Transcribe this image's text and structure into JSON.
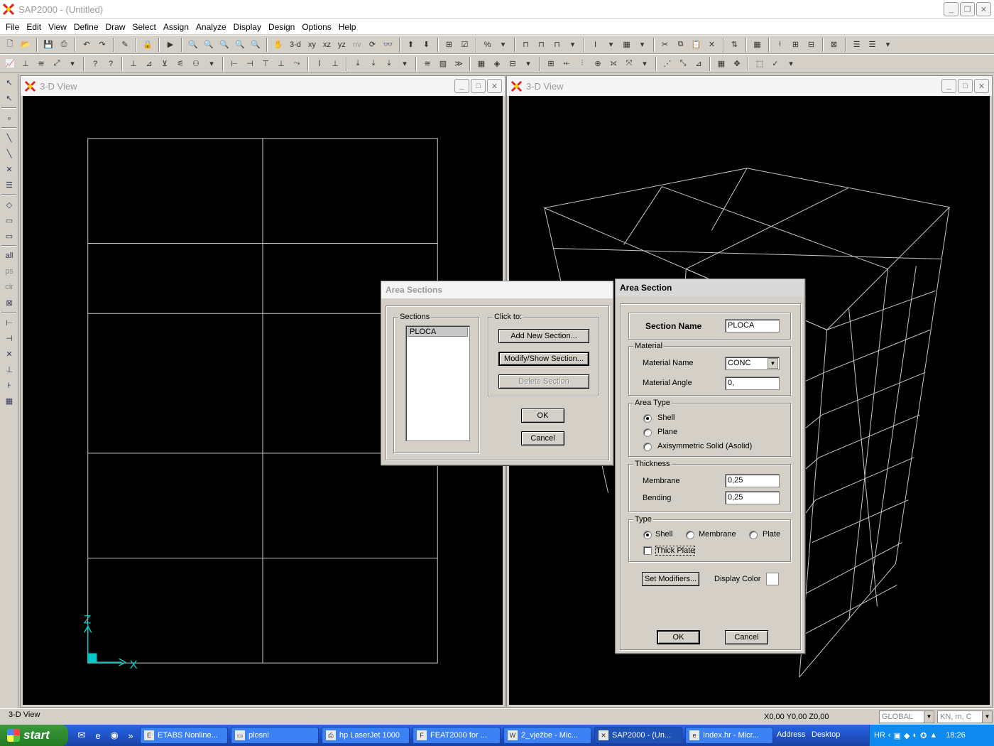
{
  "app": {
    "title": "SAP2000 - (Untitled)"
  },
  "menu": [
    "File",
    "Edit",
    "View",
    "Define",
    "Draw",
    "Select",
    "Assign",
    "Analyze",
    "Display",
    "Design",
    "Options",
    "Help"
  ],
  "toolbar1": {
    "view_3d": "3-d",
    "view_xy": "xy",
    "view_xz": "xz",
    "view_yz": "yz",
    "view_nv": "nv"
  },
  "left_toolbar": {
    "all": "all",
    "ps": "ps",
    "clr": "clr"
  },
  "views": [
    {
      "title": "3-D View",
      "axes": {
        "z": "Z",
        "x": "X"
      }
    },
    {
      "title": "3-D View"
    }
  ],
  "area_sections_dialog": {
    "title": "Area Sections",
    "sections_label": "Sections",
    "sections": [
      "PLOCA"
    ],
    "click_to_label": "Click to:",
    "add_button": "Add New Section...",
    "modify_button": "Modify/Show Section...",
    "delete_button": "Delete Section",
    "ok": "OK",
    "cancel": "Cancel"
  },
  "area_section_dialog": {
    "title": "Area Section",
    "section_name_label": "Section Name",
    "section_name": "PLOCA",
    "material_group": "Material",
    "material_name_label": "Material Name",
    "material_name": "CONC",
    "material_angle_label": "Material Angle",
    "material_angle": "0,",
    "area_type_group": "Area Type",
    "area_type_options": [
      "Shell",
      "Plane",
      "Axisymmetric Solid (Asolid)"
    ],
    "area_type_selected": "Shell",
    "thickness_group": "Thickness",
    "membrane_label": "Membrane",
    "membrane": "0,25",
    "bending_label": "Bending",
    "bending": "0,25",
    "type_group": "Type",
    "type_options": [
      "Shell",
      "Membrane",
      "Plate"
    ],
    "type_selected": "Shell",
    "thick_plate_label": "Thick Plate",
    "thick_plate_checked": false,
    "set_modifiers_button": "Set Modifiers...",
    "display_color_label": "Display Color",
    "ok": "OK",
    "cancel": "Cancel"
  },
  "status": {
    "left": "3-D View",
    "coords": "X0,00  Y0,00  Z0,00",
    "coord_system": "GLOBAL",
    "units": "KN, m, C"
  },
  "taskbar": {
    "start": "start",
    "tasks": [
      "ETABS Nonline...",
      "plosni",
      "hp LaserJet 1000",
      "FEAT2000 for ...",
      "2_vježbe - Mic...",
      "SAP2000 - (Un...",
      "Index.hr - Micr..."
    ],
    "address": "Address",
    "desktop": "Desktop",
    "lang": "HR",
    "clock": "18:26"
  },
  "colors": {
    "canvas": "#000000",
    "grid": "#c8c8c8",
    "axis": "#00c8c8"
  }
}
